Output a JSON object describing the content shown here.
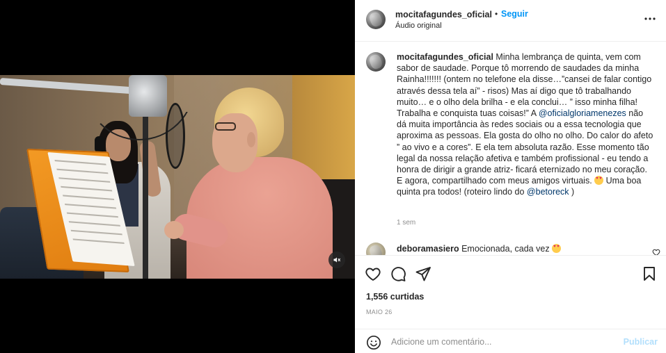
{
  "post": {
    "username": "mocitafagundes_oficial",
    "follow_label": "Seguir",
    "audio_label": "Áudio original",
    "separator": "•"
  },
  "caption": {
    "username": "mocitafagundes_oficial",
    "text_1": " Minha lembrança de quinta, vem com sabor de saudade. Porque tô morrendo de saudades da minha Rainha!!!!!!! (ontem no telefone ela disse…”cansei de falar contigo através dessa tela aí” - risos) Mas aí digo que tô trabalhando muito… e o olho dela brilha - e ela conclui… ” isso minha filha! Trabalha e conquista tuas coisas!” A ",
    "mention_1": "@oficialgloriamenezes",
    "text_2": " não dá muita importância às redes sociais ou a essa tecnologia que aproxima as pessoas. Ela gosta do olho no olho. Do calor do afeto ” ao vivo e a cores”. E ela tem absoluta razão. Esse momento tão legal da nossa relação afetiva e também profissional - eu tendo a honra de dirigir a grande atriz- ficará eternizado no meu coração. E agora, compartilhado com meus amigos virtuais. ",
    "text_3": " Uma boa quinta pra todos! (roteiro lindo do ",
    "mention_2": "@betoreck",
    "text_4": " )",
    "time": "1 sem"
  },
  "comments": [
    {
      "username": "deboramasiero",
      "text": " Emocionada, cada vez"
    }
  ],
  "stats": {
    "likes": "1,556 curtidas",
    "date": "MAIO 26"
  },
  "add_comment": {
    "placeholder": "Adicione um comentário...",
    "publish_label": "Publicar"
  },
  "icons": {
    "more": "more-horizontal-icon",
    "like": "heart-icon",
    "comment": "comment-icon",
    "share": "paper-plane-icon",
    "save": "bookmark-icon",
    "emoji": "smiley-icon",
    "mute": "speaker-muted-icon"
  }
}
